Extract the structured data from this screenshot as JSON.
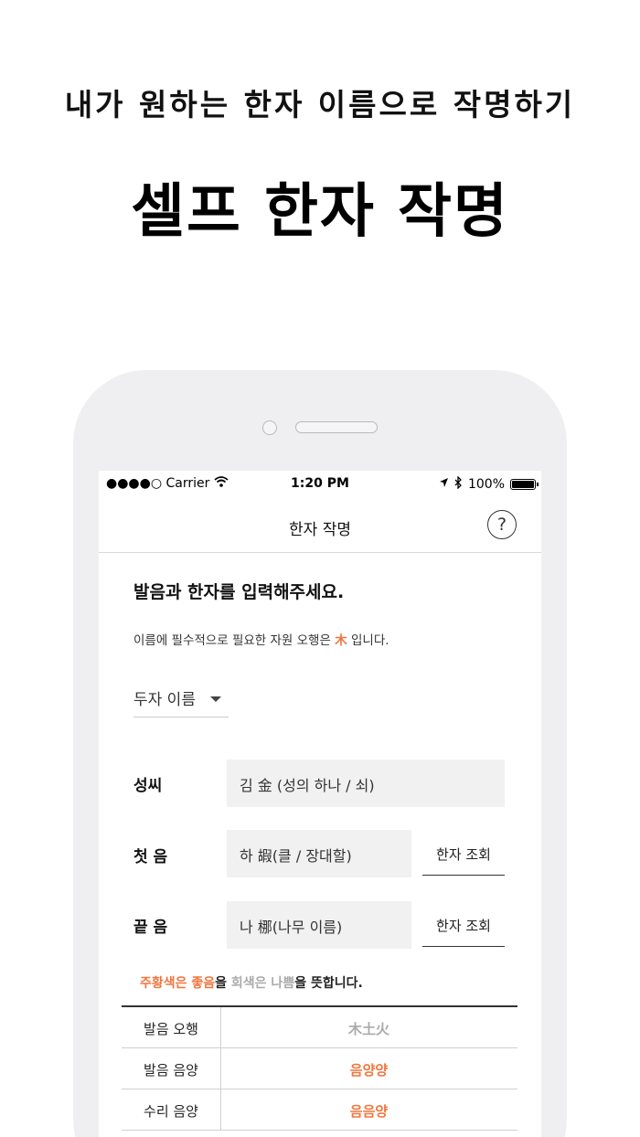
{
  "promo": {
    "subtitle": "내가 원하는 한자 이름으로 작명하기",
    "title": "셀프 한자 작명"
  },
  "status_bar": {
    "carrier": "●●●●○ Carrier",
    "time": "1:20 PM",
    "battery": "100%",
    "battery_level": 1.0
  },
  "nav": {
    "title": "한자 작명",
    "help": "?"
  },
  "form": {
    "heading": "발음과 한자를 입력해주세요.",
    "notice_prefix": "이름에 필수적으로 필요한 자원 오행은",
    "notice_element": "木",
    "notice_suffix": "입니다.",
    "name_type": "두자 이름",
    "rows": [
      {
        "label": "성씨",
        "value": "김 金 (성의 하나 / 쇠)"
      },
      {
        "label": "첫 음",
        "value": "하 嘏(클 / 장대할)",
        "button": "한자 조회"
      },
      {
        "label": "끝 음",
        "value": "나 梛(나무 이름)",
        "button": "한자 조회"
      }
    ]
  },
  "legend": {
    "good": "주황색은 좋음",
    "mid1": "을",
    "bad": "회색은 나쁨",
    "end": "을 뜻합니다."
  },
  "results": [
    {
      "label": "발음 오행",
      "value": "木土火",
      "status": "bad"
    },
    {
      "label": "발음 음양",
      "value": "음양양",
      "status": "good"
    },
    {
      "label": "수리 음양",
      "value": "음음양",
      "status": "good"
    }
  ],
  "colors": {
    "accent": "#f0763e",
    "muted": "#aaaaaa",
    "field_bg": "#f1f1f1",
    "phone_bezel": "#efeff1"
  }
}
